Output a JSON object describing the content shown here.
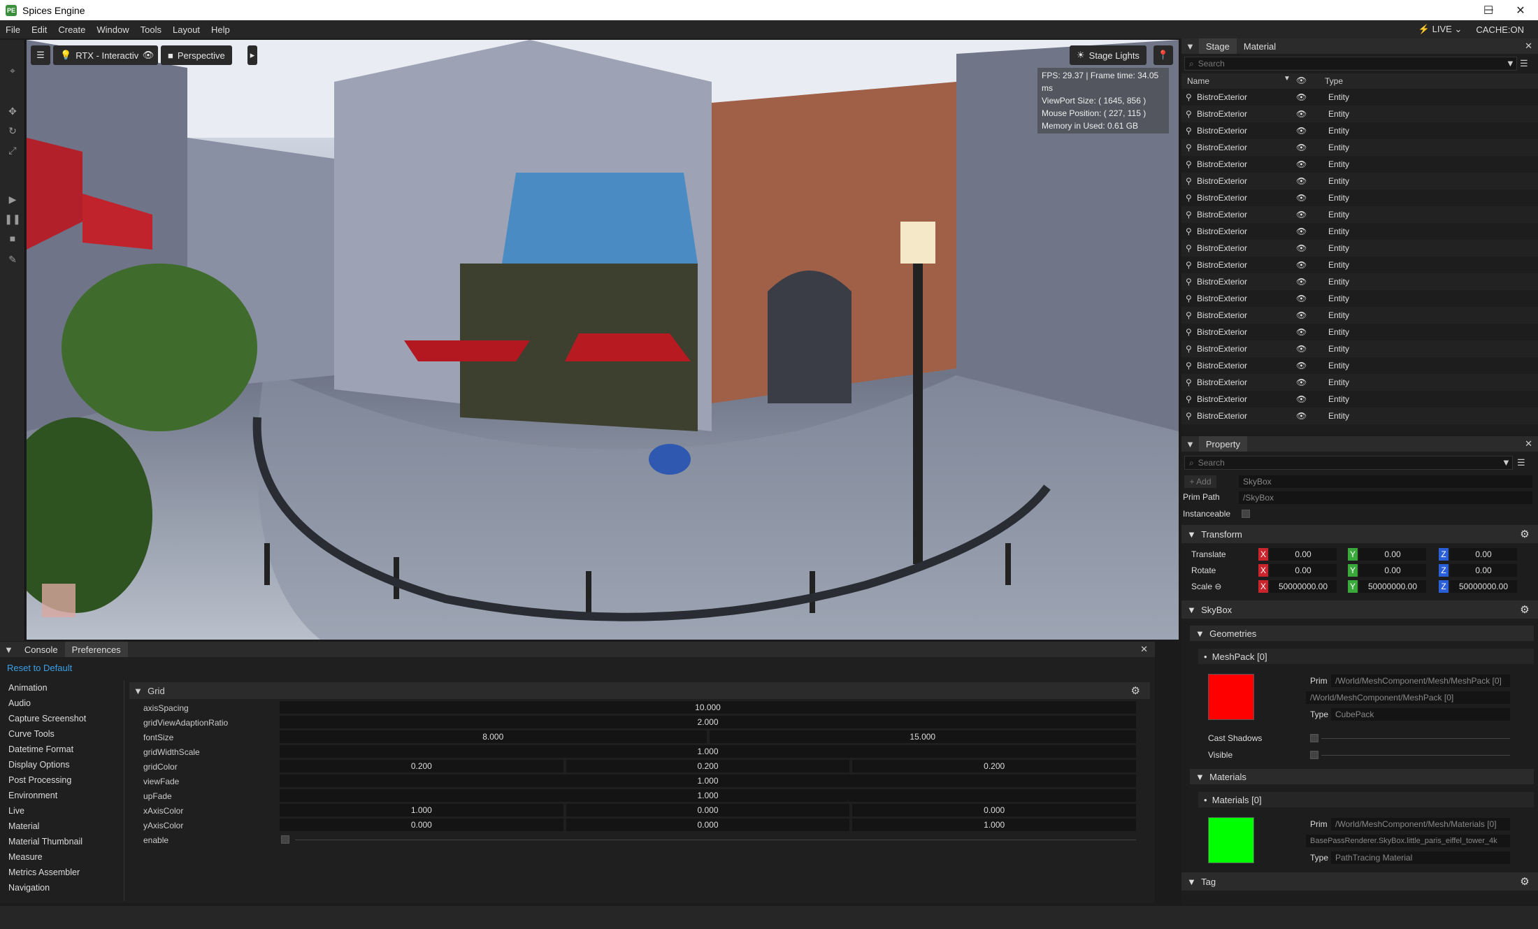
{
  "window": {
    "title": "Spices Engine",
    "icon_text": "PE",
    "minimize": "─",
    "maximize": "☐",
    "close": "✕"
  },
  "menu": {
    "items": [
      "File",
      "Edit",
      "Create",
      "Window",
      "Tools",
      "Layout",
      "Help"
    ],
    "live": "LIVE",
    "live_arrow": "⌄",
    "cache": "CACHE:ON"
  },
  "viewport": {
    "render_mode": "RTX - Interactive",
    "camera": "Perspective",
    "stage_lights": "Stage Lights",
    "stats": [
      "FPS: 29.37 | Frame time: 34.05 ms",
      "ViewPort Size: ( 1645, 856 )",
      "Mouse Position: ( 227, 115 )",
      "Memory in Used: 0.61 GB"
    ]
  },
  "stage": {
    "tabs": [
      "Stage",
      "Material"
    ],
    "search_placeholder": "Search",
    "columns": {
      "name": "Name",
      "type": "Type"
    },
    "rows": [
      {
        "name": "BistroExterior",
        "type": "Entity"
      },
      {
        "name": "BistroExterior",
        "type": "Entity"
      },
      {
        "name": "BistroExterior",
        "type": "Entity"
      },
      {
        "name": "BistroExterior",
        "type": "Entity"
      },
      {
        "name": "BistroExterior",
        "type": "Entity"
      },
      {
        "name": "BistroExterior",
        "type": "Entity"
      },
      {
        "name": "BistroExterior",
        "type": "Entity"
      },
      {
        "name": "BistroExterior",
        "type": "Entity"
      },
      {
        "name": "BistroExterior",
        "type": "Entity"
      },
      {
        "name": "BistroExterior",
        "type": "Entity"
      },
      {
        "name": "BistroExterior",
        "type": "Entity"
      },
      {
        "name": "BistroExterior",
        "type": "Entity"
      },
      {
        "name": "BistroExterior",
        "type": "Entity"
      },
      {
        "name": "BistroExterior",
        "type": "Entity"
      },
      {
        "name": "BistroExterior",
        "type": "Entity"
      },
      {
        "name": "BistroExterior",
        "type": "Entity"
      },
      {
        "name": "BistroExterior",
        "type": "Entity"
      },
      {
        "name": "BistroExterior",
        "type": "Entity"
      },
      {
        "name": "BistroExterior",
        "type": "Entity"
      },
      {
        "name": "BistroExterior",
        "type": "Entity"
      }
    ]
  },
  "property": {
    "title": "Property",
    "search_placeholder": "Search",
    "add_label": "+ Add",
    "name_value": "SkyBox",
    "prim_path_label": "Prim Path",
    "prim_path_value": "/SkyBox",
    "instanceable_label": "Instanceable",
    "transform": {
      "title": "Transform",
      "rows": [
        {
          "label": "Translate",
          "x": "0.00",
          "y": "0.00",
          "z": "0.00"
        },
        {
          "label": "Rotate",
          "x": "0.00",
          "y": "0.00",
          "z": "0.00"
        },
        {
          "label": "Scale ⊖",
          "x": "50000000.00",
          "y": "50000000.00",
          "z": "50000000.00"
        }
      ]
    },
    "skybox": {
      "title": "SkyBox",
      "geometries": "Geometries",
      "meshpack": "MeshPack [0]",
      "prim_label": "Prim",
      "mesh_prim": "/World/MeshComponent/Mesh/MeshPack [0]",
      "mesh_prim2": "/World/MeshComponent/MeshPack [0]",
      "type_label": "Type",
      "mesh_type": "CubePack",
      "cast_shadows": "Cast Shadows",
      "visible": "Visible",
      "materials": "Materials",
      "materials0": "Materials [0]",
      "mat_prim": "/World/MeshComponent/Mesh/Materials [0]",
      "mat_prim2": "BasePassRenderer.SkyBox.little_paris_eiffel_tower_4k",
      "mat_type": "PathTracing Material",
      "mesh_color": "#ff0000",
      "mat_color": "#00ff00"
    },
    "tag": {
      "title": "Tag"
    }
  },
  "console": {
    "tabs": [
      "Console",
      "Preferences"
    ],
    "reset": "Reset to Default",
    "categories": [
      "Animation",
      "Audio",
      "Capture Screenshot",
      "Curve Tools",
      "Datetime Format",
      "Display Options",
      "Post Processing",
      "Environment",
      "Live",
      "Material",
      "Material Thumbnail",
      "Measure",
      "Metrics Assembler",
      "Navigation"
    ],
    "grid_title": "Grid",
    "grid_rows": [
      {
        "label": "axisSpacing",
        "values": [
          "10.000"
        ]
      },
      {
        "label": "gridViewAdaptionRatio",
        "values": [
          "2.000"
        ]
      },
      {
        "label": "fontSize",
        "values": [
          "8.000",
          "15.000"
        ]
      },
      {
        "label": "gridWidthScale",
        "values": [
          "1.000"
        ]
      },
      {
        "label": "gridColor",
        "values": [
          "0.200",
          "0.200",
          "0.200"
        ]
      },
      {
        "label": "viewFade",
        "values": [
          "1.000"
        ]
      },
      {
        "label": "upFade",
        "values": [
          "1.000"
        ]
      },
      {
        "label": "xAxisColor",
        "values": [
          "1.000",
          "0.000",
          "0.000"
        ]
      },
      {
        "label": "yAxisColor",
        "values": [
          "0.000",
          "0.000",
          "1.000"
        ]
      },
      {
        "label": "enable",
        "values": []
      }
    ]
  },
  "colors": {
    "accent": "#3aa0e8",
    "x_axis": "#c8262c",
    "y_axis": "#3aa83a",
    "z_axis": "#2a5fd8"
  }
}
